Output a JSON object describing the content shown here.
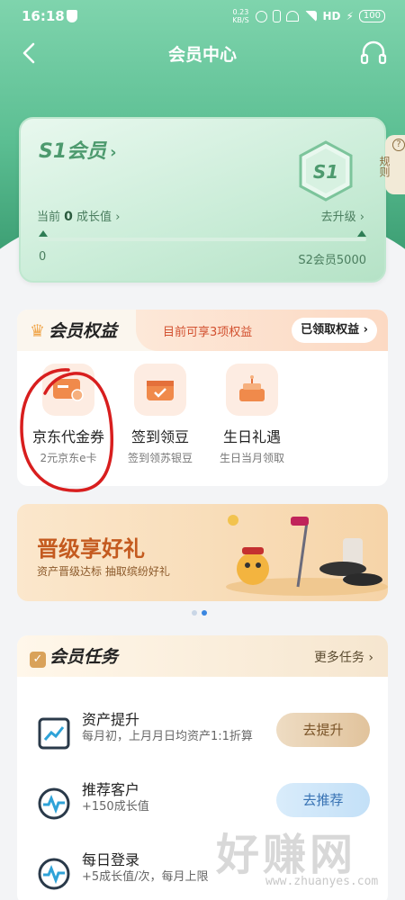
{
  "status_bar": {
    "time": "16:18",
    "net_speed": "0.23 KB/S",
    "network": "HD",
    "battery": "100"
  },
  "nav": {
    "title": "会员中心"
  },
  "member_card": {
    "level": "S1会员",
    "badge": "S1",
    "growth_label_prefix": "当前",
    "growth_value": "0",
    "growth_label_suffix": "成长值",
    "upgrade": "去升级",
    "progress_start": "0",
    "progress_end": "S2会员5000",
    "progress_fraction": 0
  },
  "rules_tab": {
    "label": "规则",
    "icon": "question-icon"
  },
  "benefits": {
    "title": "会员权益",
    "subtitle": "目前可享3项权益",
    "claimed_button": "已领取权益",
    "items": [
      {
        "label": "京东代金券",
        "desc": "2元京东e卡",
        "icon": "card-icon"
      },
      {
        "label": "签到领豆",
        "desc": "签到领苏银豆",
        "icon": "checkin-icon"
      },
      {
        "label": "生日礼遇",
        "desc": "生日当月领取",
        "icon": "cake-icon"
      }
    ]
  },
  "promo": {
    "title": "晋级享好礼",
    "subtitle": "资产晋级达标 抽取缤纷好礼"
  },
  "tasks": {
    "title": "会员任务",
    "more": "更多任务",
    "items": [
      {
        "name": "资产提升",
        "desc": "每月初，上月月日均资产1:1折算",
        "button": "去提升",
        "style": "gold",
        "icon": "trend-icon"
      },
      {
        "name": "推荐客户",
        "desc": "+150成长值",
        "button": "去推荐",
        "style": "blue",
        "icon": "pulse-icon"
      },
      {
        "name": "每日登录",
        "desc": "+5成长值/次，每月上限",
        "button": "",
        "style": "blue",
        "icon": "pulse-icon"
      }
    ]
  },
  "watermark": {
    "text": "好赚网",
    "url": "www.zhuanyes.com"
  },
  "colors": {
    "primary_green": "#5cbf93",
    "accent_red": "#d2502f",
    "gold": "#d9a25a"
  }
}
